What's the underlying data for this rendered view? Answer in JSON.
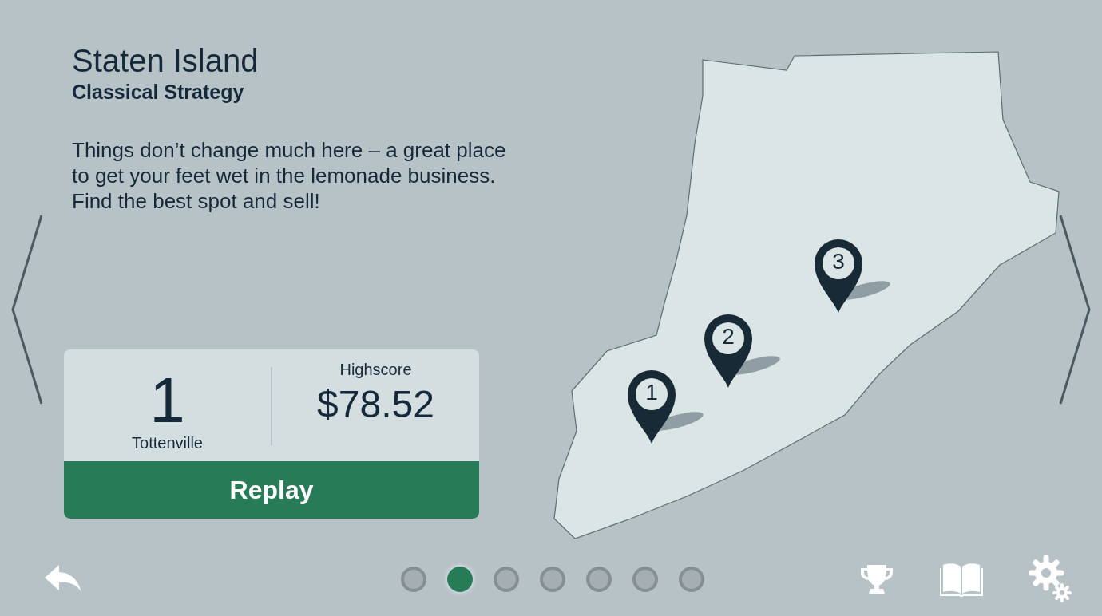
{
  "title": "Staten Island",
  "subtitle": "Classical Strategy",
  "description": "Things don’t change much here – a great place to get your feet wet in the lemonade business. Find the best spot and sell!",
  "score_card": {
    "rank": "1",
    "location": "Tottenville",
    "highscore_label": "Highscore",
    "highscore": "$78.52",
    "button": "Replay"
  },
  "map": {
    "pins": [
      {
        "label": "1"
      },
      {
        "label": "2"
      },
      {
        "label": "3"
      }
    ]
  },
  "pages": [
    {
      "selected": false
    },
    {
      "selected": true
    },
    {
      "selected": false
    },
    {
      "selected": false
    },
    {
      "selected": false
    },
    {
      "selected": false
    },
    {
      "selected": false
    }
  ]
}
